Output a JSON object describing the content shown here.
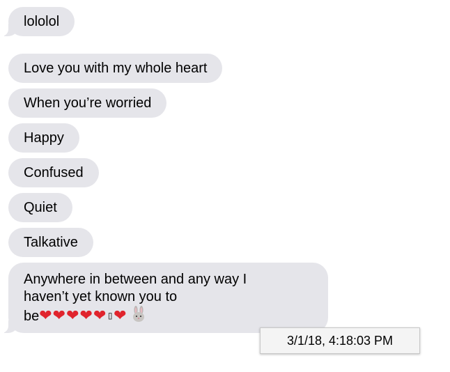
{
  "messages": [
    {
      "text": "lololol"
    },
    {
      "text": "Love you with my whole heart"
    },
    {
      "text": "When you’re worried"
    },
    {
      "text": "Happy"
    },
    {
      "text": "Confused"
    },
    {
      "text": "Quiet"
    },
    {
      "text": "Talkative"
    },
    {
      "line1": "Anywhere in between and any way I",
      "line2": "haven’t yet known you to",
      "line3_text": "be",
      "hearts_a": "❤❤❤❤❤",
      "missing_glyph": "▯",
      "hearts_b": "❤",
      "emoji_icon": "rabbit-face-icon"
    }
  ],
  "tooltip": {
    "timestamp": "3/1/18, 4:18:03 PM"
  },
  "colors": {
    "incoming_bubble": "#e5e5ea",
    "heart": "#e0242d"
  }
}
